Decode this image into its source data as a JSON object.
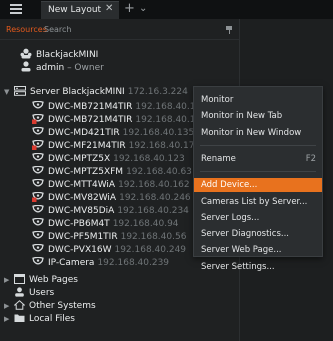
{
  "titlebar": {
    "tab_label": "New Layout",
    "tab_close": "✕",
    "add": "+",
    "chevron": "⌄"
  },
  "panel": {
    "tabs": {
      "resources": "Resources",
      "search": "Search"
    },
    "system_name": "BlackjackMINI",
    "user": {
      "name": "admin",
      "role": " – Owner"
    }
  },
  "server": {
    "name": "Server BlackjackMINI",
    "ip": "172.16.3.224"
  },
  "cameras": [
    {
      "name": "DWC-MB721M4TIR",
      "ip": "192.168.40.1",
      "status": "online"
    },
    {
      "name": "DWC-MB721M4TIR",
      "ip": "192.168.40.1",
      "status": "alert"
    },
    {
      "name": "DWC-MD421TIR",
      "ip": "192.168.40.135",
      "status": "online"
    },
    {
      "name": "DWC-MF21M4TIR",
      "ip": "192.168.40.17",
      "status": "alert"
    },
    {
      "name": "DWC-MPTZ5X",
      "ip": "192.168.40.123",
      "status": "online"
    },
    {
      "name": "DWC-MPTZ5XFM",
      "ip": "192.168.40.63",
      "status": "online"
    },
    {
      "name": "DWC-MTT4WiA",
      "ip": "192.168.40.162",
      "status": "online"
    },
    {
      "name": "DWC-MV82WiA",
      "ip": "192.168.40.246",
      "status": "alert"
    },
    {
      "name": "DWC-MV85DiA",
      "ip": "192.168.40.234",
      "status": "online"
    },
    {
      "name": "DWC-PB6M4T",
      "ip": "192.168.40.94",
      "status": "online"
    },
    {
      "name": "DWC-PF5M1TIR",
      "ip": "192.168.40.56",
      "status": "online"
    },
    {
      "name": "DWC-PVX16W",
      "ip": "192.168.40.249",
      "status": "online"
    },
    {
      "name": "IP-Camera",
      "ip": "192.168.40.239",
      "status": "online"
    }
  ],
  "categories": {
    "web_pages": "Web Pages",
    "users": "Users",
    "other_systems": "Other Systems",
    "local_files": "Local Files"
  },
  "context_menu": {
    "monitor": "Monitor",
    "monitor_new_tab": "Monitor in New Tab",
    "monitor_new_window": "Monitor in New Window",
    "rename": "Rename",
    "rename_shortcut": "F2",
    "add_device": "Add Device...",
    "cameras_list": "Cameras List by Server...",
    "server_logs": "Server Logs...",
    "server_diagnostics": "Server Diagnostics...",
    "server_web_page": "Server Web Page...",
    "server_settings": "Server Settings..."
  },
  "colors": {
    "accent": "#e35a1d",
    "highlight": "#e8721e",
    "alert": "#d93b30"
  }
}
